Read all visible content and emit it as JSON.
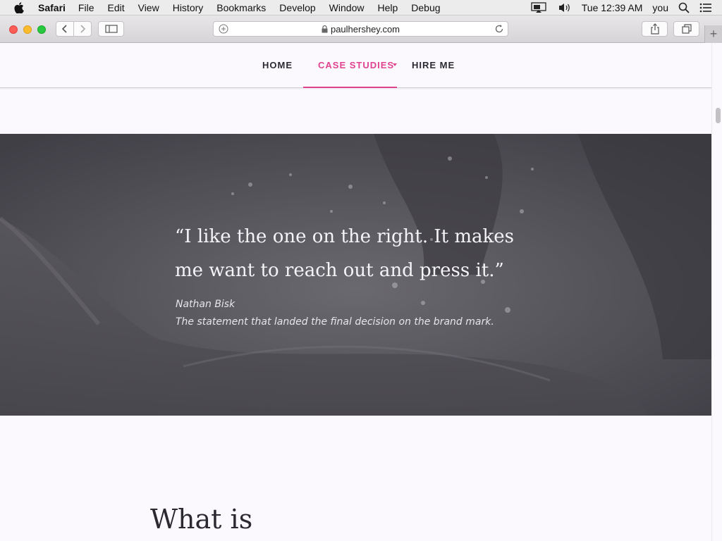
{
  "menubar": {
    "app_name": "Safari",
    "items": [
      "File",
      "Edit",
      "View",
      "History",
      "Bookmarks",
      "Develop",
      "Window",
      "Help",
      "Debug"
    ],
    "clock": "Tue 12:39 AM",
    "user": "you"
  },
  "browser": {
    "url": "paulhershey.com"
  },
  "site": {
    "nav": {
      "home": "HOME",
      "case_studies": "CASE STUDIES",
      "hire_me": "HIRE ME"
    },
    "accent_color": "#e0438f",
    "testimonial": {
      "quote": "“I like the one on the right. It makes me want to reach out and press it.”",
      "author": "Nathan Bisk",
      "note": "The statement that landed the final decision on the brand mark."
    },
    "section_heading": "What is"
  }
}
